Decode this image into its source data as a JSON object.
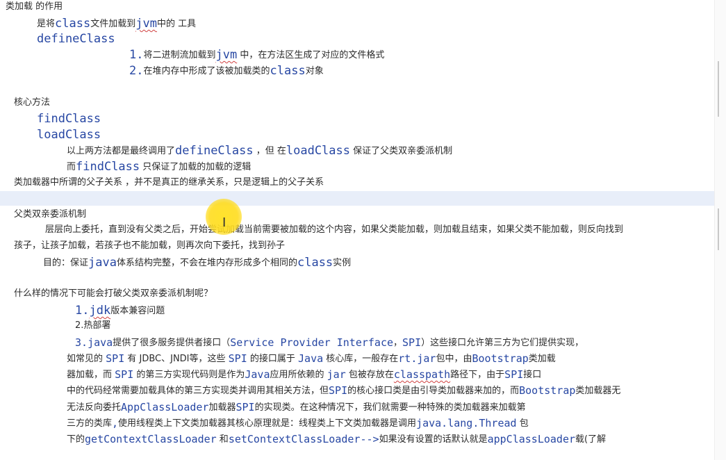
{
  "lines": {
    "l1": "类加载 的作用",
    "l2a": "是将",
    "l2b": "class",
    "l2c": "文件加载到",
    "l2d": "jvm",
    "l2e": "中的 工具",
    "l3": "defineClass",
    "l4a": "1.",
    "l4b": "将二进制流加载到",
    "l4c": "jvm",
    "l4d": " 中，在方法区生成了对应的文件格式",
    "l5a": "2.",
    "l5b": "在堆内存中形成了该被加载类的",
    "l5c": "class",
    "l5d": "对象",
    "l6": "核心方法",
    "l7": "findClass",
    "l8": "loadClass",
    "l9a": "以上两方法都是最终调用了",
    "l9b": "defineClass",
    "l9c": " ，但 在",
    "l9d": "loadClass",
    "l9e": " 保证了父类双亲委派机制",
    "l10a": "而",
    "l10b": "findClass",
    "l10c": "  只保证了加载的加载的逻辑",
    "l11": "类加载器中所谓的父子关系    ，并不是真正的继承关系，只是逻辑上的父子关系",
    "l12": "父类双亲委派机制",
    "l13": "层层向上委托，直到没有父类之后，开始尝试加载当前需要被加载的这个内容，如果父类能加载，则加载且结束，如果父类不能加载，则反向找到",
    "l14": "孩子，让孩子加载，若孩子也不能加载，则再次向下委托，找到孙子",
    "l15a": "目的：保证",
    "l15b": "java",
    "l15c": "体系结构完整，不会在堆内存形成多个相同的",
    "l15d": "class",
    "l15e": "实例",
    "l16": "什么样的情况下可能会打破父类双亲委派机制呢？",
    "l17a": "1.",
    "l17b": "jdk",
    "l17c": "版本兼容问题",
    "l18": "2.热部署",
    "l19a": "3.",
    "l19b": "java",
    "l19c": "提供了很多服务提供者接口（",
    "l19d": "Service Provider Interface",
    "l19e": "，",
    "l19f": "SPI",
    "l19g": "）这些接口允许第三方为它们提供实现，",
    "l20a": "如常见的 ",
    "l20b": "SPI",
    "l20c": " 有 JDBC、JNDI等，这些 ",
    "l20d": "SPI",
    "l20e": " 的接口属于 ",
    "l20f": "Java",
    "l20g": " 核心库，一般存在",
    "l20h": "rt.jar",
    "l20i": "包中，由",
    "l20j": "Bootstrap",
    "l20k": "类加载",
    "l21a": "器加载，而 ",
    "l21b": "SPI",
    "l21c": " 的第三方实现代码则是作为",
    "l21d": "Java",
    "l21e": "应用所依赖的 ",
    "l21f": "jar",
    "l21g": " 包被存放在",
    "l21h": "classpath",
    "l21i": "路径下，由于",
    "l21j": "SPI",
    "l21k": "接口",
    "l22a": "中的代码经常需要加载具体的第三方实现类并调用其相关方法，但",
    "l22b": "SPI",
    "l22c": "的核心接口类是由引导类加载器来加的，而",
    "l22d": "Bootstrap",
    "l22e": "类加载器无",
    "l23a": "无法反向委托",
    "l23b": "AppClassLoader",
    "l23c": "加载器",
    "l23d": "SPI",
    "l23e": "的实现类。在这种情况下，我们就需要一种特殊的类加载器来加载第",
    "l24a": "三方的类库",
    "l24b": ",",
    "l24c": "使用线程类上下文类加载器其核心原理就是：线程类上下文类加载器是调用",
    "l24d": "java.lang.Thread",
    "l24e": " 包",
    "l25a": "下的",
    "l25b": "getContextClassLoader",
    "l25c": " 和",
    "l25d": "setContextClassLoader-->",
    "l25e": "如果没有设置的话默认就是",
    "l25f": "appClassLoader",
    "l25g": "载(了解"
  },
  "colors": {
    "code": "#2747a3",
    "text": "#2b2b2b",
    "line_highlight": "#e8eef9",
    "cursor_highlight": "#ffe228"
  },
  "icons": {
    "cursor": "text-ibeam-cursor"
  }
}
